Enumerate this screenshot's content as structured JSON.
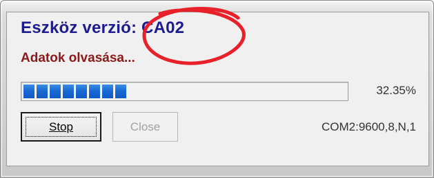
{
  "dialog": {
    "device_version_label": "Eszköz verzió: CA02",
    "status_text": "Adatok olvasása...",
    "progress": {
      "percent_text": "32.35%",
      "fraction": 0.3235
    },
    "buttons": {
      "stop_label": "Stop",
      "close_label": "Close"
    },
    "port_info": "COM2:9600,8,N,1"
  },
  "colors": {
    "version_text": "#1c1c8e",
    "status_text": "#8b1b1b",
    "progress_fill": "#1767d2",
    "annotation_circle": "#e8202a"
  }
}
